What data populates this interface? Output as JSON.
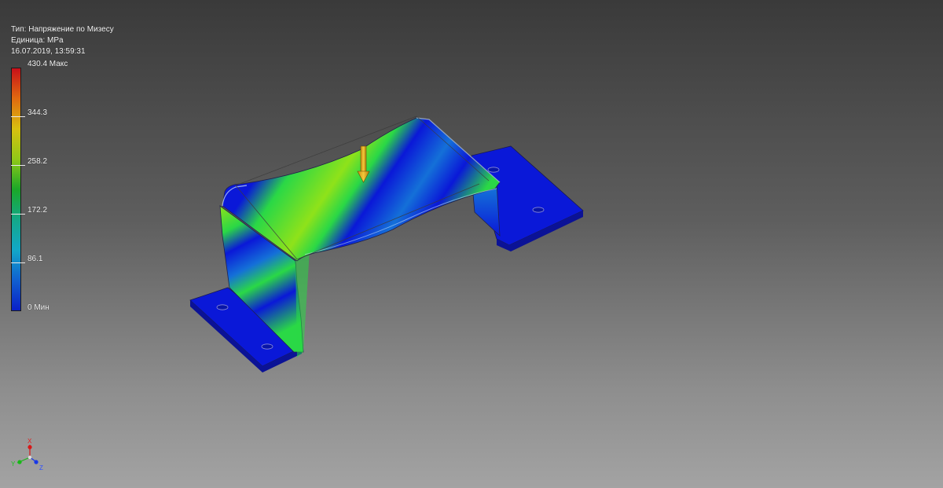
{
  "info": {
    "type_line": "Тип: Напряжение по Мизесу",
    "unit_line": "Единица: MPa",
    "timestamp": "16.07.2019, 13:59:31"
  },
  "legend": {
    "colors": [
      "#c8101a",
      "#e06a10",
      "#d8c010",
      "#90c818",
      "#1aa828",
      "#14a888",
      "#12a8c8",
      "#1060d0",
      "#0a20c8"
    ],
    "labels": {
      "max": "430.4 Макс",
      "l4": "344.3",
      "l3": "258.2",
      "l2": "172.2",
      "l1": "86.1",
      "min": "0 Мин"
    }
  },
  "axes": {
    "x": "X",
    "y": "Y",
    "z": "Z"
  },
  "model": {
    "low_color": "#0a18d8",
    "mid_color": "#2ad846",
    "high_color": "#8fe21a",
    "load_arrow_color": "#e8b018"
  }
}
